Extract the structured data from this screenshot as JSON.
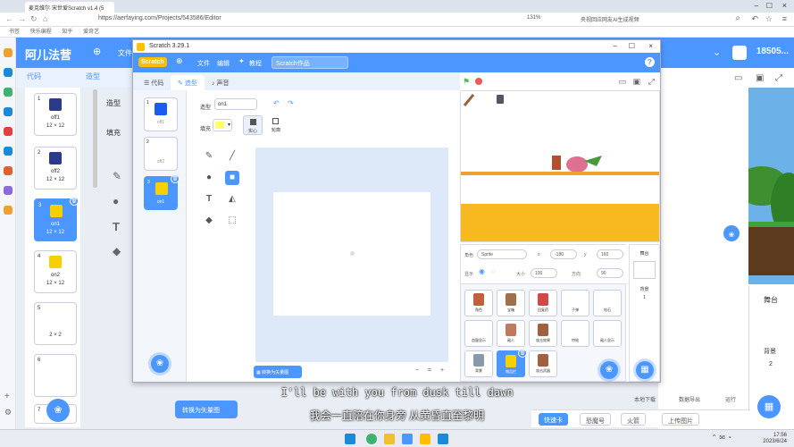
{
  "browser": {
    "tab_title": "麦克维尔·宋世爱Scratch v1.4 (5",
    "url": "https://aerfaying.com/Projects/543586/Editor",
    "zoom": "131%",
    "search_hint": "央视回应网友AI生成视频",
    "bookmarks": [
      "书签",
      "快乐编程",
      "知乎",
      "爱奇艺"
    ]
  },
  "site": {
    "logo": "阿儿法营",
    "file_menu": "文件",
    "user": "18505...",
    "tabs": [
      "代码",
      "造型"
    ],
    "costume_label_partial": "造型",
    "fill_label_partial": "填充"
  },
  "bg_costumes": [
    {
      "num": "1",
      "name": "off1",
      "size": "12 × 12",
      "color": "#2b3a8c"
    },
    {
      "num": "2",
      "name": "off2",
      "size": "12 × 12",
      "color": "#2b3a8c"
    },
    {
      "num": "3",
      "name": "on1",
      "size": "12 × 12",
      "color": "#f6d000"
    },
    {
      "num": "4",
      "name": "on2",
      "size": "12 × 12",
      "color": "#f6d000"
    },
    {
      "num": "5",
      "name": "",
      "size": "2 × 2",
      "color": ""
    },
    {
      "num": "6",
      "name": "",
      "size": "",
      "color": ""
    },
    {
      "num": "7",
      "name": "",
      "size": "",
      "color": ""
    }
  ],
  "bg_bottom": {
    "convert_btn": "转换为矢量图",
    "stage_label": "舞台",
    "backdrop_label": "背景",
    "backdrop_count": "2",
    "quick_btn": "快速卡",
    "buttons": [
      "恐魔号",
      "火箭",
      "上传图片"
    ],
    "misc": [
      "本地下载",
      "数据导出",
      "运行"
    ]
  },
  "scratch": {
    "window_title": "Scratch 3.29.1",
    "logo": "Scratch",
    "menu": [
      "文件",
      "编辑",
      "教程"
    ],
    "project_title": "Scratch作品",
    "help": "?",
    "tabs": [
      "代码",
      "造型",
      "声音"
    ],
    "costumes": [
      {
        "num": "1",
        "label": "off1",
        "color": "#1a5bf0"
      },
      {
        "num": "2",
        "label": "off2",
        "color": ""
      },
      {
        "num": "3",
        "label": "on1",
        "color": "#f6d000"
      }
    ],
    "costume_name_label": "造型",
    "costume_name": "on1",
    "fill_label": "填充",
    "fill_color": "#ffff66",
    "modes": [
      "实心",
      "轮廓"
    ],
    "convert_btn": "转换为矢量图",
    "zoom": [
      "−",
      "=",
      "+"
    ],
    "sprite_info": {
      "sprite_label": "角色",
      "sprite_name": "Sprite",
      "x_label": "x",
      "x_value": "-180",
      "y_label": "y",
      "y_value": "160",
      "show_label": "显示",
      "size_label": "大小",
      "size_value": "100",
      "direction_label": "方向",
      "direction_value": "90"
    },
    "sprites": [
      {
        "name": "角色",
        "color": "#c0603c"
      },
      {
        "name": "宝箱",
        "color": "#a0704a"
      },
      {
        "name": "回复药",
        "color": "#d04a4a"
      },
      {
        "name": "子弹",
        "color": ""
      },
      {
        "name": "钻石",
        "color": ""
      },
      {
        "name": "血量显示",
        "color": ""
      },
      {
        "name": "敌人",
        "color": "#c07860"
      },
      {
        "name": "攻击效果",
        "color": "#a06040"
      },
      {
        "name": "特效",
        "color": ""
      },
      {
        "name": "敌人显示",
        "color": ""
      },
      {
        "name": "背景",
        "color": "#8899aa"
      },
      {
        "name": "物品栏",
        "color": "#f6d000"
      },
      {
        "name": "攻击武器",
        "color": "#a06040"
      }
    ],
    "stage_pane": {
      "title": "舞台",
      "backdrop_label": "背景",
      "backdrop_count": "1"
    }
  },
  "subtitles": {
    "en": "I'll be with you from dusk till dawn",
    "zh": "我会一直陪在你身旁 从黄昏直至黎明"
  },
  "taskbar": {
    "time": "17:56",
    "date": "2023/6/24"
  }
}
